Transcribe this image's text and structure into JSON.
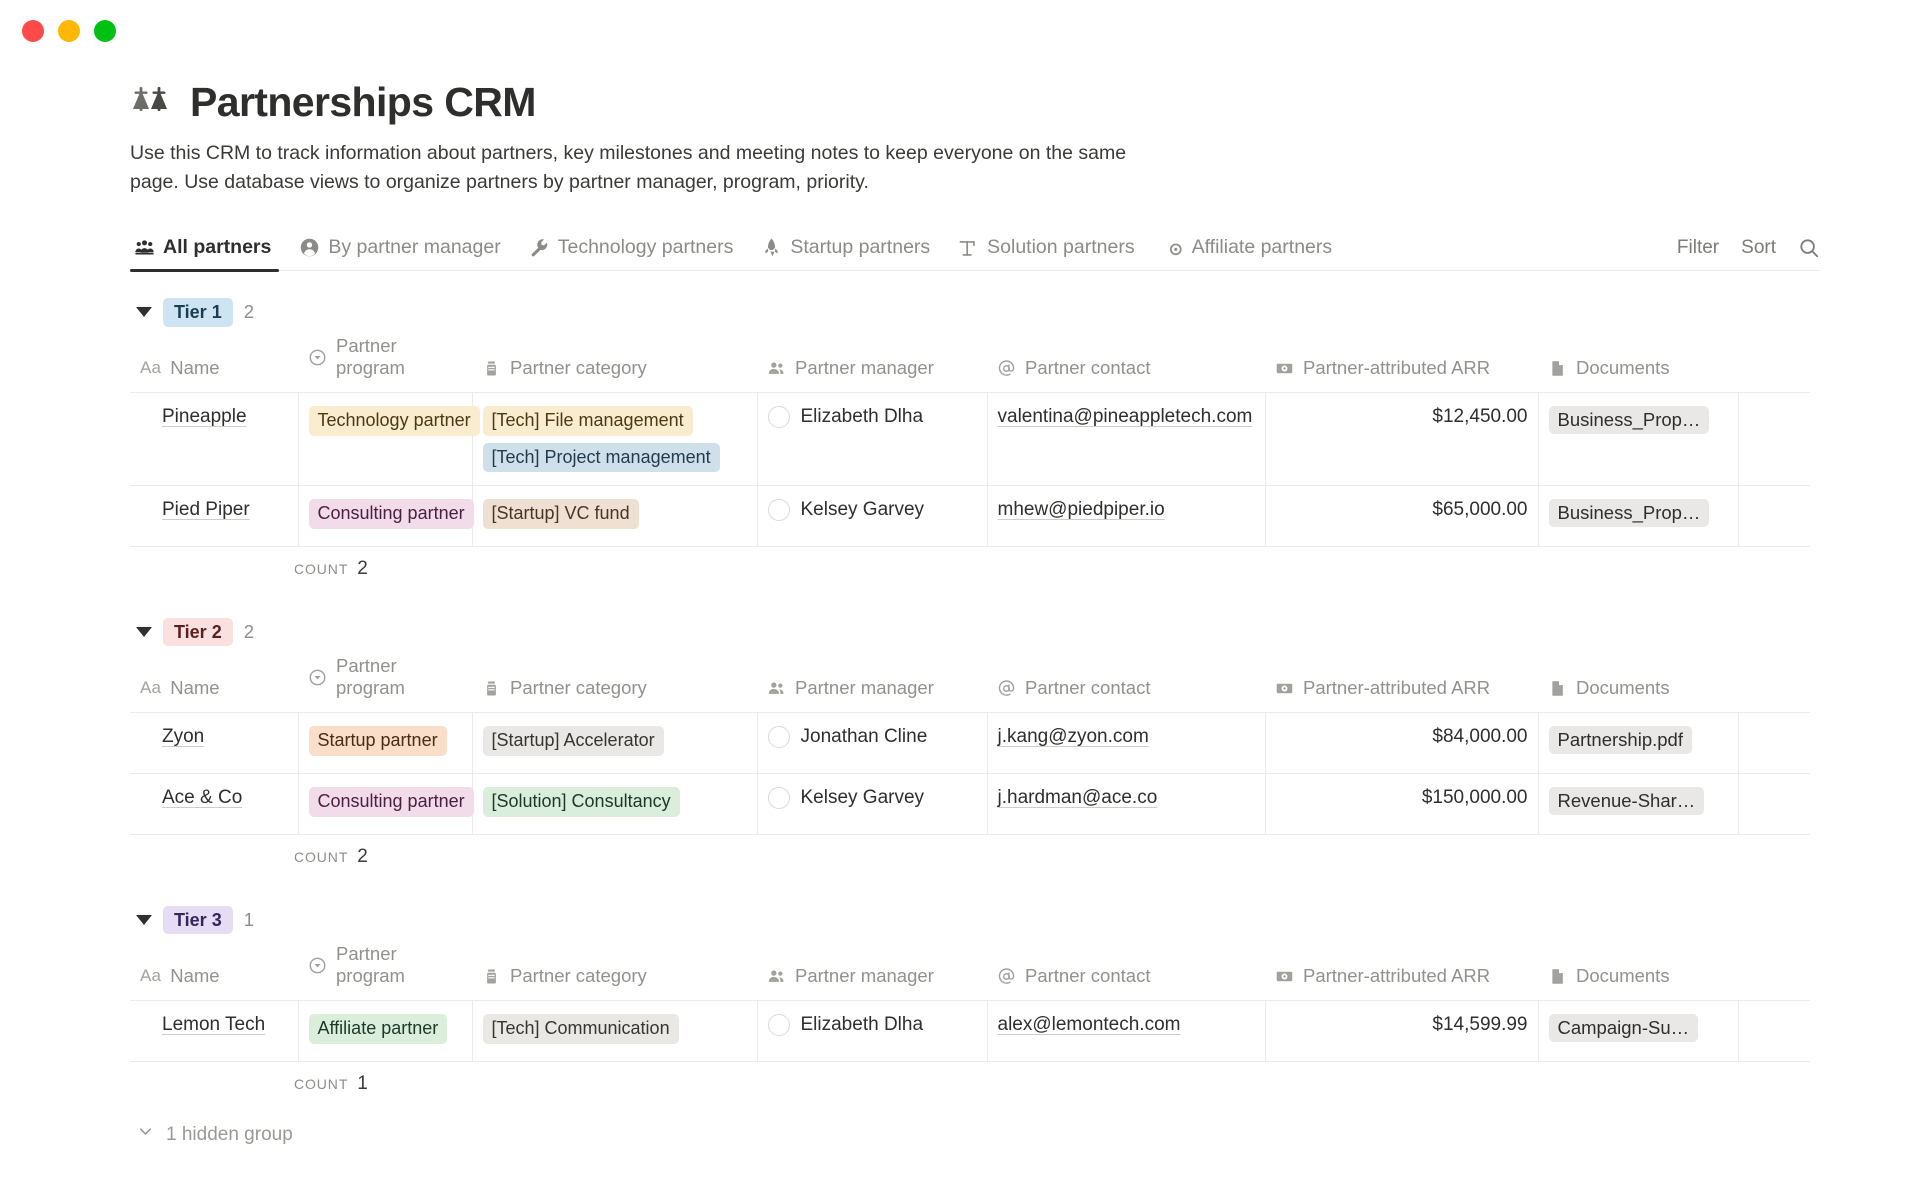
{
  "window": {
    "close_label": "close",
    "minimize_label": "minimize",
    "maximize_label": "maximize"
  },
  "header": {
    "title": "Partnerships CRM",
    "icon": "bridge-icon",
    "description": "Use this CRM to track information about partners, key milestones and meeting notes to keep everyone on the same page. Use database views to organize partners by partner manager, program, priority."
  },
  "tabs": [
    {
      "label": "All partners",
      "icon": "people-group-icon",
      "active": true
    },
    {
      "label": "By partner manager",
      "icon": "person-circle-icon",
      "active": false
    },
    {
      "label": "Technology partners",
      "icon": "wrench-icon",
      "active": false
    },
    {
      "label": "Startup partners",
      "icon": "rocket-icon",
      "active": false
    },
    {
      "label": "Solution partners",
      "icon": "crane-icon",
      "active": false
    },
    {
      "label": "Affiliate partners",
      "icon": "link-circle-icon",
      "active": false
    }
  ],
  "view_tools": {
    "filter_label": "Filter",
    "sort_label": "Sort",
    "search_icon": "search-icon"
  },
  "columns": [
    {
      "label": "Name",
      "icon": "aa-text-icon"
    },
    {
      "label": "Partner program",
      "icon": "select-circle-icon"
    },
    {
      "label": "Partner category",
      "icon": "multiselect-icon"
    },
    {
      "label": "Partner manager",
      "icon": "people-icon"
    },
    {
      "label": "Partner contact",
      "icon": "at-email-icon"
    },
    {
      "label": "Partner-attributed ARR",
      "icon": "money-icon"
    },
    {
      "label": "Documents",
      "icon": "file-icon"
    }
  ],
  "count_label": "COUNT",
  "groups": [
    {
      "badge": "Tier 1",
      "badge_bg": "#cfe4f2",
      "badge_fg": "#1b3d52",
      "count": "2",
      "count_total": "2",
      "rows": [
        {
          "name": "Pineapple",
          "program": {
            "text": "Technology partner",
            "bg": "#faeccf",
            "fg": "#4a3a14"
          },
          "categories": [
            {
              "text": "[Tech] File management",
              "bg": "#faeccf",
              "fg": "#4a3a14"
            },
            {
              "text": "[Tech] Project management",
              "bg": "#cfe0eb",
              "fg": "#1f3b4d"
            }
          ],
          "manager": "Elizabeth Dlha",
          "contact": "valentina@pineappletech.com",
          "arr": "$12,450.00",
          "document": "Business_Prop…"
        },
        {
          "name": "Pied Piper",
          "program": {
            "text": "Consulting partner",
            "bg": "#f2dcea",
            "fg": "#4a1f3d"
          },
          "categories": [
            {
              "text": "[Startup] VC fund",
              "bg": "#efe0d4",
              "fg": "#4a3524"
            }
          ],
          "manager": "Kelsey Garvey",
          "contact": "mhew@piedpiper.io",
          "arr": "$65,000.00",
          "document": "Business_Prop…"
        }
      ]
    },
    {
      "badge": "Tier 2",
      "badge_bg": "#fbe0e0",
      "badge_fg": "#5c1f1f",
      "count": "2",
      "count_total": "2",
      "rows": [
        {
          "name": "Zyon",
          "program": {
            "text": "Startup partner",
            "bg": "#fadec9",
            "fg": "#4a2b14"
          },
          "categories": [
            {
              "text": "[Startup] Accelerator",
              "bg": "#e9e8e6",
              "fg": "#37352f"
            }
          ],
          "manager": "Jonathan Cline",
          "contact": "j.kang@zyon.com",
          "arr": "$84,000.00",
          "document": "Partnership.pdf"
        },
        {
          "name": "Ace & Co",
          "program": {
            "text": "Consulting partner",
            "bg": "#f2dcea",
            "fg": "#4a1f3d"
          },
          "categories": [
            {
              "text": "[Solution] Consultancy",
              "bg": "#dbeddb",
              "fg": "#1c3829"
            }
          ],
          "manager": "Kelsey Garvey",
          "contact": "j.hardman@ace.co",
          "arr": "$150,000.00",
          "document": "Revenue-Shar…"
        }
      ]
    },
    {
      "badge": "Tier 3",
      "badge_bg": "#e6ddf5",
      "badge_fg": "#36245c",
      "count": "1",
      "count_total": "1",
      "rows": [
        {
          "name": "Lemon Tech",
          "program": {
            "text": "Affiliate partner",
            "bg": "#dbeddb",
            "fg": "#1c3829"
          },
          "categories": [
            {
              "text": "[Tech] Communication",
              "bg": "#eae8e5",
              "fg": "#37352f"
            }
          ],
          "manager": "Elizabeth Dlha",
          "contact": "alex@lemontech.com",
          "arr": "$14,599.99",
          "document": "Campaign-Su…"
        }
      ]
    }
  ],
  "footer": {
    "hidden_group_label": "1 hidden group",
    "hidden_group_icon": "chevron-down-icon"
  }
}
